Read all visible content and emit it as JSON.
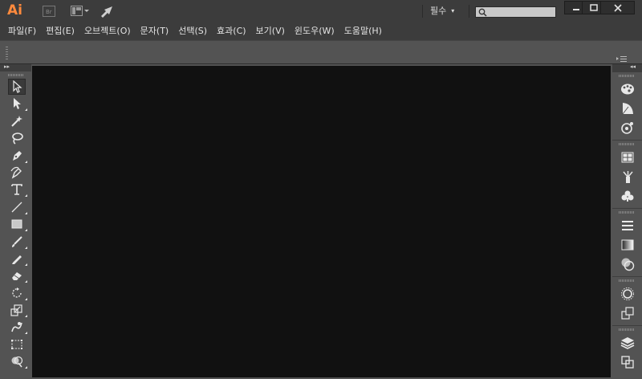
{
  "app": {
    "logo_text": "Ai",
    "workspace_label": "필수",
    "workspace_arrow": "▾",
    "search_placeholder": ""
  },
  "title_buttons": [
    {
      "name": "bridge-icon"
    },
    {
      "name": "arrange-documents-icon"
    },
    {
      "name": "sync-icon"
    }
  ],
  "menu": [
    "파일(F)",
    "편집(E)",
    "오브젝트(O)",
    "문자(T)",
    "선택(S)",
    "효과(C)",
    "보기(V)",
    "윈도우(W)",
    "도움말(H)"
  ],
  "tools": [
    "selection-tool-icon",
    "direct-selection-tool-icon",
    "magic-wand-tool-icon",
    "lasso-tool-icon",
    "pen-tool-icon",
    "curvature-tool-icon",
    "type-tool-icon",
    "line-segment-tool-icon",
    "rectangle-tool-icon",
    "paintbrush-tool-icon",
    "pencil-tool-icon",
    "eraser-tool-icon",
    "rotate-tool-icon",
    "scale-tool-icon",
    "warp-tool-icon",
    "free-transform-tool-icon",
    "shape-builder-tool-icon"
  ],
  "panels": [
    [
      "color-panel-icon",
      "color-guide-panel-icon",
      "color-themes-panel-icon"
    ],
    [
      "swatches-panel-icon",
      "brushes-panel-icon",
      "symbols-panel-icon"
    ],
    [
      "stroke-panel-icon",
      "gradient-panel-icon",
      "transparency-panel-icon"
    ],
    [
      "appearance-panel-icon",
      "graphic-styles-panel-icon"
    ],
    [
      "layers-panel-icon",
      "artboards-panel-icon"
    ]
  ],
  "colors": {
    "accent_logo": "#ff8a3d",
    "chrome": "#3c3c3c",
    "panel": "#535353",
    "canvas": "#111111"
  }
}
